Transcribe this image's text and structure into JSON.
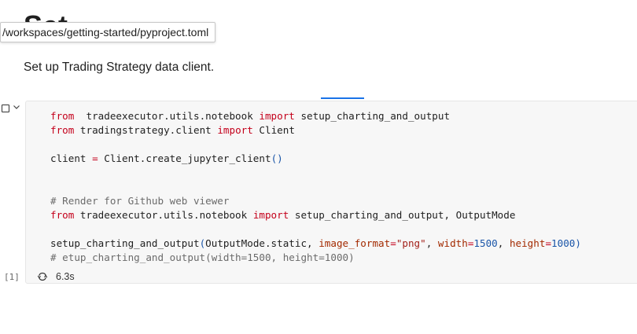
{
  "tooltip": {
    "path": "/workspaces/getting-started/pyproject.toml"
  },
  "markdown": {
    "text": "Set up Trading Strategy data client."
  },
  "cell": {
    "execution_count": "[1]",
    "duration": "6.3s",
    "lines": [
      [
        [
          "kw",
          "from"
        ],
        [
          "",
          "  tradeexecutor.utils.notebook "
        ],
        [
          "kw",
          "import"
        ],
        [
          "",
          " setup_charting_and_output"
        ]
      ],
      [
        [
          "kw",
          "from"
        ],
        [
          "",
          " tradingstrategy.client "
        ],
        [
          "kw",
          "import"
        ],
        [
          "",
          " Client"
        ]
      ],
      [],
      [
        [
          "",
          "client "
        ],
        [
          "op",
          "="
        ],
        [
          "",
          " Client.create_jupyter_client"
        ],
        [
          "paren",
          "()"
        ]
      ],
      [],
      [],
      [
        [
          "comment",
          "# Render for Github web viewer"
        ]
      ],
      [
        [
          "kw",
          "from"
        ],
        [
          "",
          " tradeexecutor.utils.notebook "
        ],
        [
          "kw",
          "import"
        ],
        [
          "",
          " setup_charting_and_output, OutputMode"
        ]
      ],
      [],
      [
        [
          "",
          "setup_charting_and_output"
        ],
        [
          "paren",
          "("
        ],
        [
          "",
          "OutputMode.static, "
        ],
        [
          "param",
          "image_format"
        ],
        [
          "op",
          "="
        ],
        [
          "str",
          "\"png\""
        ],
        [
          "",
          ", "
        ],
        [
          "param",
          "width"
        ],
        [
          "op",
          "="
        ],
        [
          "num",
          "1500"
        ],
        [
          "",
          ", "
        ],
        [
          "param",
          "height"
        ],
        [
          "op",
          "="
        ],
        [
          "num",
          "1000"
        ],
        [
          "paren",
          ")"
        ]
      ],
      [
        [
          "comment",
          "# etup_charting_and_output(width=1500, height=1000)"
        ]
      ]
    ]
  },
  "icons": {
    "checkbox": "checkbox-icon",
    "chevron": "chevron-down-icon",
    "status": "refresh-icon"
  },
  "colors": {
    "keyword": "#c4001b",
    "number": "#1a55a8",
    "focus": "#1a73e8"
  }
}
